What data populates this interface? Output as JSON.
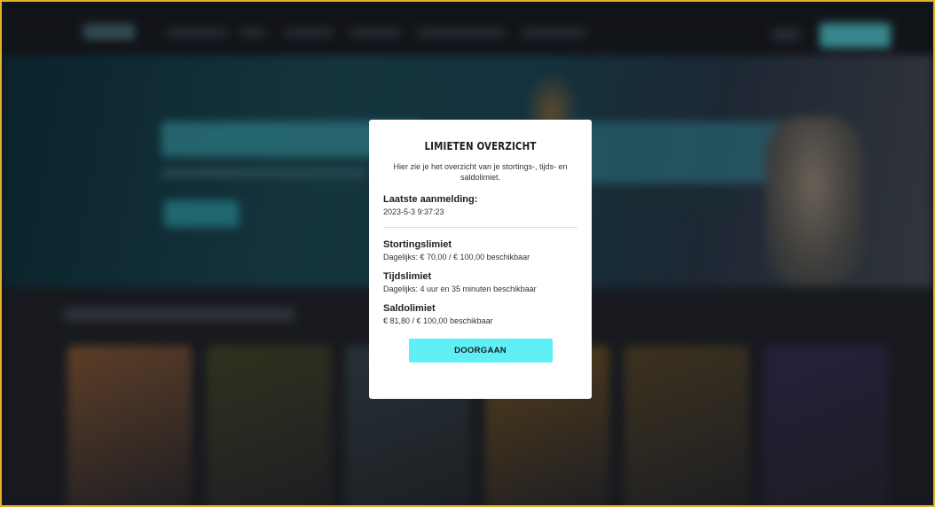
{
  "colors": {
    "accent": "#5ff0f6",
    "frame_border": "#e0b22c",
    "modal_bg": "#ffffff"
  },
  "modal": {
    "title": "LIMIETEN OVERZICHT",
    "intro": "Hier zie je het overzicht van je stortings-, tijds- en saldolimiet.",
    "last_login": {
      "label": "Laatste aanmelding:",
      "value": "2023-5-3 9:37:23"
    },
    "deposit_limit": {
      "label": "Stortingslimiet",
      "value": "Dagelijks:  € 70,00 / € 100,00 beschikbaar"
    },
    "time_limit": {
      "label": "Tijdslimiet",
      "value": "Dagelijks:  4 uur en 35 minuten beschikbaar"
    },
    "balance_limit": {
      "label": "Saldolimiet",
      "value": "€ 81,80 / € 100,00 beschikbaar"
    },
    "continue_button": "DOORGAAN"
  },
  "background": {
    "game_tile_colors": [
      "#8a5c3a",
      "#4a4a2e",
      "#3a4a52",
      "#7a5a2a",
      "#5a4a2e",
      "#3a2e5a"
    ]
  }
}
